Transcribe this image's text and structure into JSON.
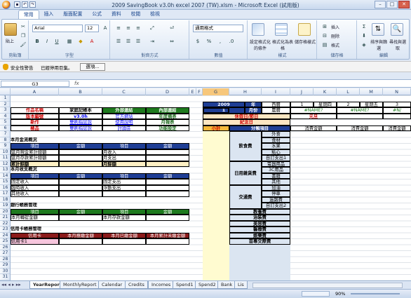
{
  "window": {
    "title": "2009 SavingBook v3.0h excel 2007 (TW).xlsm - Microsoft Excel (試用版)",
    "controls": [
      "–",
      "□",
      "✕"
    ]
  },
  "ribbon_tabs": [
    "常用",
    "插入",
    "版面配置",
    "公式",
    "資料",
    "校閱",
    "檢視"
  ],
  "ribbon": {
    "groups": [
      "剪貼簿",
      "字型",
      "對齊方式",
      "數值",
      "樣式",
      "儲存格",
      "編輯"
    ],
    "paste_label": "貼上",
    "font_name": "Arial",
    "font_size": "12",
    "number_format": "通用格式",
    "styles": [
      "設定格式化的條件",
      "格式化為表格",
      "儲存格樣式"
    ],
    "cells": [
      "插入",
      "刪除",
      "格式"
    ],
    "editing": [
      "排序與篩選",
      "尋找與選取"
    ]
  },
  "security": {
    "title": "安全性警告",
    "message": "已經停用巨集。",
    "options": "選項..."
  },
  "formula_bar": {
    "cell": "G3",
    "fx": "fx"
  },
  "columns": [
    "A",
    "B",
    "C",
    "D",
    "E",
    "F",
    "G",
    "H",
    "I",
    "J",
    "K",
    "L",
    "M",
    "N"
  ],
  "rows": [
    "1",
    "2",
    "3",
    "4",
    "5",
    "6",
    "7",
    "8",
    "9",
    "10",
    "11",
    "12",
    "13",
    "14",
    "15",
    "16",
    "17",
    "18",
    "19",
    "20",
    "21",
    "22",
    "23",
    "24",
    "25",
    "26",
    "27",
    "28",
    "29",
    "30",
    "31"
  ],
  "left": {
    "menu": [
      [
        "作品名稱",
        "家庭記帳本",
        "外部連結",
        "內部連結"
      ],
      [
        "版本編號",
        "v3.0h",
        "官方網站",
        "年度摘表"
      ],
      [
        "新作",
        "雙刷指認說",
        "使用說明",
        "月報表"
      ],
      [
        "極品",
        "雙刷指認說",
        "討論區",
        "功能設定"
      ]
    ],
    "sec1_title": "本月金流概況",
    "sec1_head": [
      "項目",
      "金額",
      "項目",
      "金額"
    ],
    "sec1_rows": [
      [
        "當月現金累計總額",
        "",
        "月收入",
        ""
      ],
      [
        "當月存款累計總額",
        "",
        "月支出",
        ""
      ],
      [
        "累計餘額",
        "",
        "月餘額",
        ""
      ]
    ],
    "sec2_title": "本月收支概況",
    "sec2_head": [
      "項目",
      "金額",
      "項目",
      "金額"
    ],
    "sec2_rows": [
      [
        "固定收入",
        "",
        "固定支出",
        ""
      ],
      [
        "臨時收入",
        "",
        "浮動支出",
        ""
      ],
      [
        "其他收入",
        "",
        "",
        ""
      ]
    ],
    "sec3_title": "銀行帳務管理",
    "sec3_head": [
      "項目",
      "金額",
      "項目",
      "金額"
    ],
    "sec3_rows": [
      [
        "本月轉提金額",
        "",
        "本月存款金額",
        ""
      ]
    ],
    "sec4_title": "信用卡帳務管理",
    "sec4_head": [
      "信用卡",
      "本月應繳金額",
      "本月已繳金額",
      "本月累計未繳金額"
    ],
    "sec4_rows": [
      [
        "信用卡1",
        "",
        "",
        ""
      ]
    ]
  },
  "right": {
    "year": "2009",
    "year_label": "年",
    "month": "1",
    "month_label": "月份",
    "calendar": [
      "西曆",
      "農曆"
    ],
    "holiday": "休假日/節日",
    "memorial": "紀念日",
    "subtotal": "小計",
    "category_head": "分類項目",
    "days": [
      {
        "num": "1",
        "weekday": "星期四",
        "lunar": "#NAME?",
        "holiday": "元旦"
      },
      {
        "num": "2",
        "weekday": "星期五",
        "lunar": "#NAME?",
        "holiday": ""
      },
      {
        "num": "3",
        "weekday": "",
        "lunar": "#N/",
        "holiday": ""
      }
    ],
    "amount_head": "消費金額",
    "groups": [
      {
        "name": "飲食費",
        "items": [
          "外食",
          "食材",
          "水果",
          "點心",
          "自訂支出1"
        ]
      },
      {
        "name": "日用雜貨費",
        "items": [
          "電器用品",
          "3C用品",
          "書籍",
          "其他"
        ]
      },
      {
        "name": "交通費",
        "items": [
          "加油",
          "停車",
          "過路費",
          "自訂支出2"
        ]
      }
    ],
    "singles": [
      "教養費",
      "治裝費",
      "美容費",
      "醫療費",
      "娛樂費",
      "首專交際費"
    ]
  },
  "sheet_tabs": [
    "YearReport",
    "MonthlyReport",
    "Calendar",
    "Credits",
    "Incomes",
    "Spend1",
    "Spend2",
    "Bank",
    "Lis"
  ],
  "status": {
    "zoom": "90%"
  }
}
